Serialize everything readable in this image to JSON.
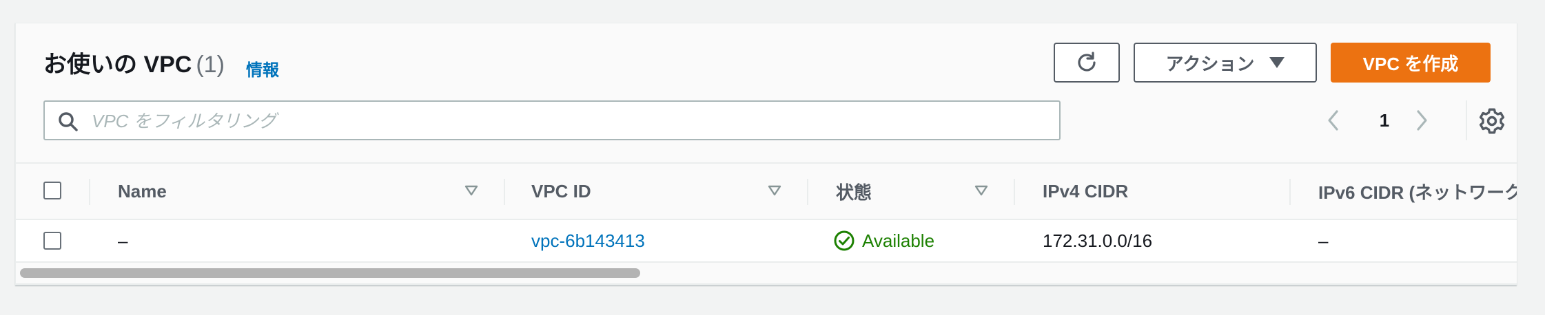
{
  "header": {
    "title": "お使いの VPC",
    "count": "(1)",
    "info_link": "情報"
  },
  "toolbar": {
    "refresh_icon": "refresh-icon",
    "actions_label": "アクション",
    "create_label": "VPC を作成"
  },
  "search": {
    "placeholder": "VPC をフィルタリング",
    "value": ""
  },
  "pagination": {
    "current_page": "1"
  },
  "table": {
    "columns": [
      "Name",
      "VPC ID",
      "状態",
      "IPv4 CIDR",
      "IPv6 CIDR (ネットワーク"
    ],
    "rows": [
      {
        "name": "–",
        "vpc_id": "vpc-6b143413",
        "status": "Available",
        "ipv4_cidr": "172.31.0.0/16",
        "ipv6_cidr": "–"
      }
    ]
  },
  "colors": {
    "primary_button": "#ec7211",
    "link": "#0073bb",
    "status_available": "#1d8102",
    "text": "#16191f",
    "secondary_text": "#545b64"
  }
}
